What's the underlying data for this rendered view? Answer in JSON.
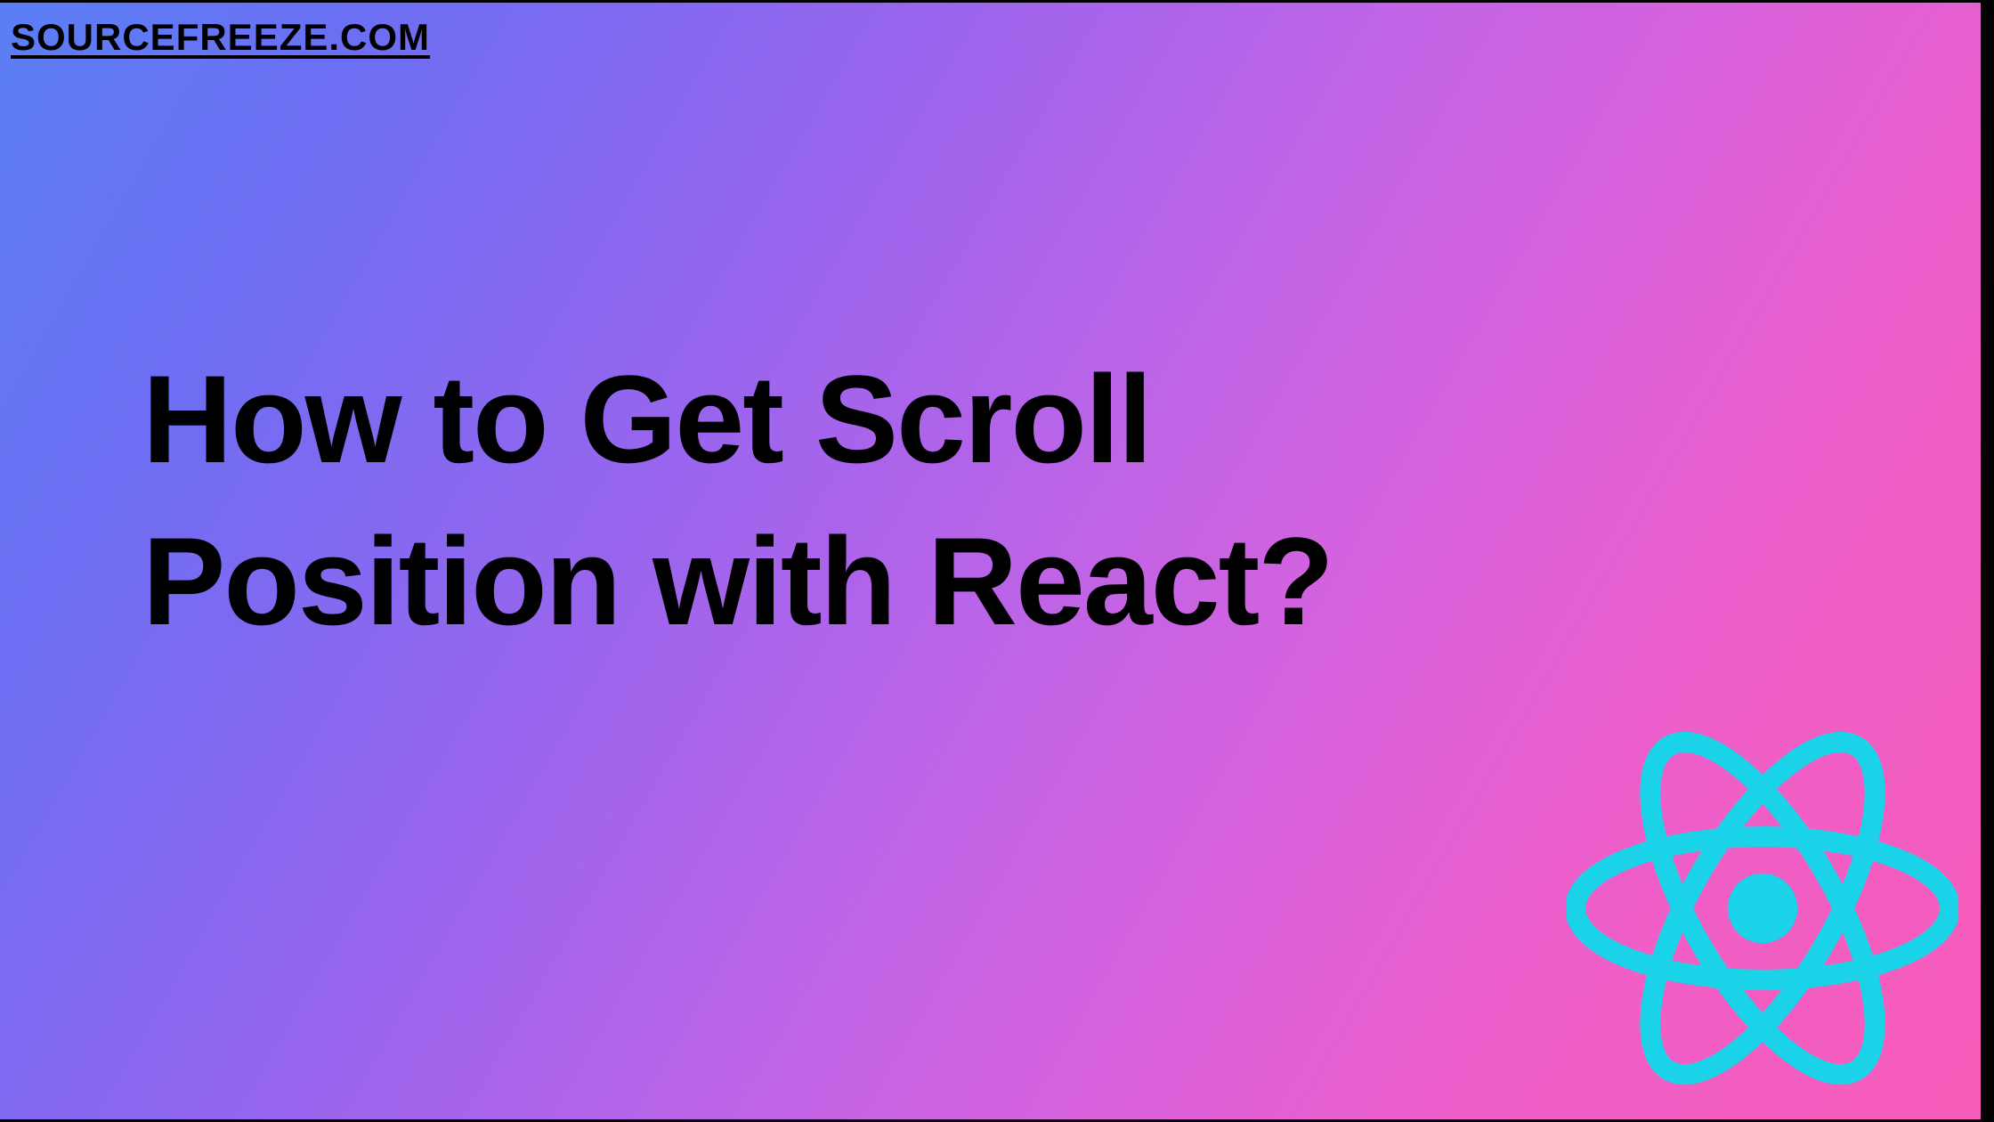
{
  "site_label": "SOURCEFREEZE.COM",
  "title_line1": "How to Get Scroll",
  "title_line2": "Position with React?",
  "icon_color": "#1bd3e8"
}
